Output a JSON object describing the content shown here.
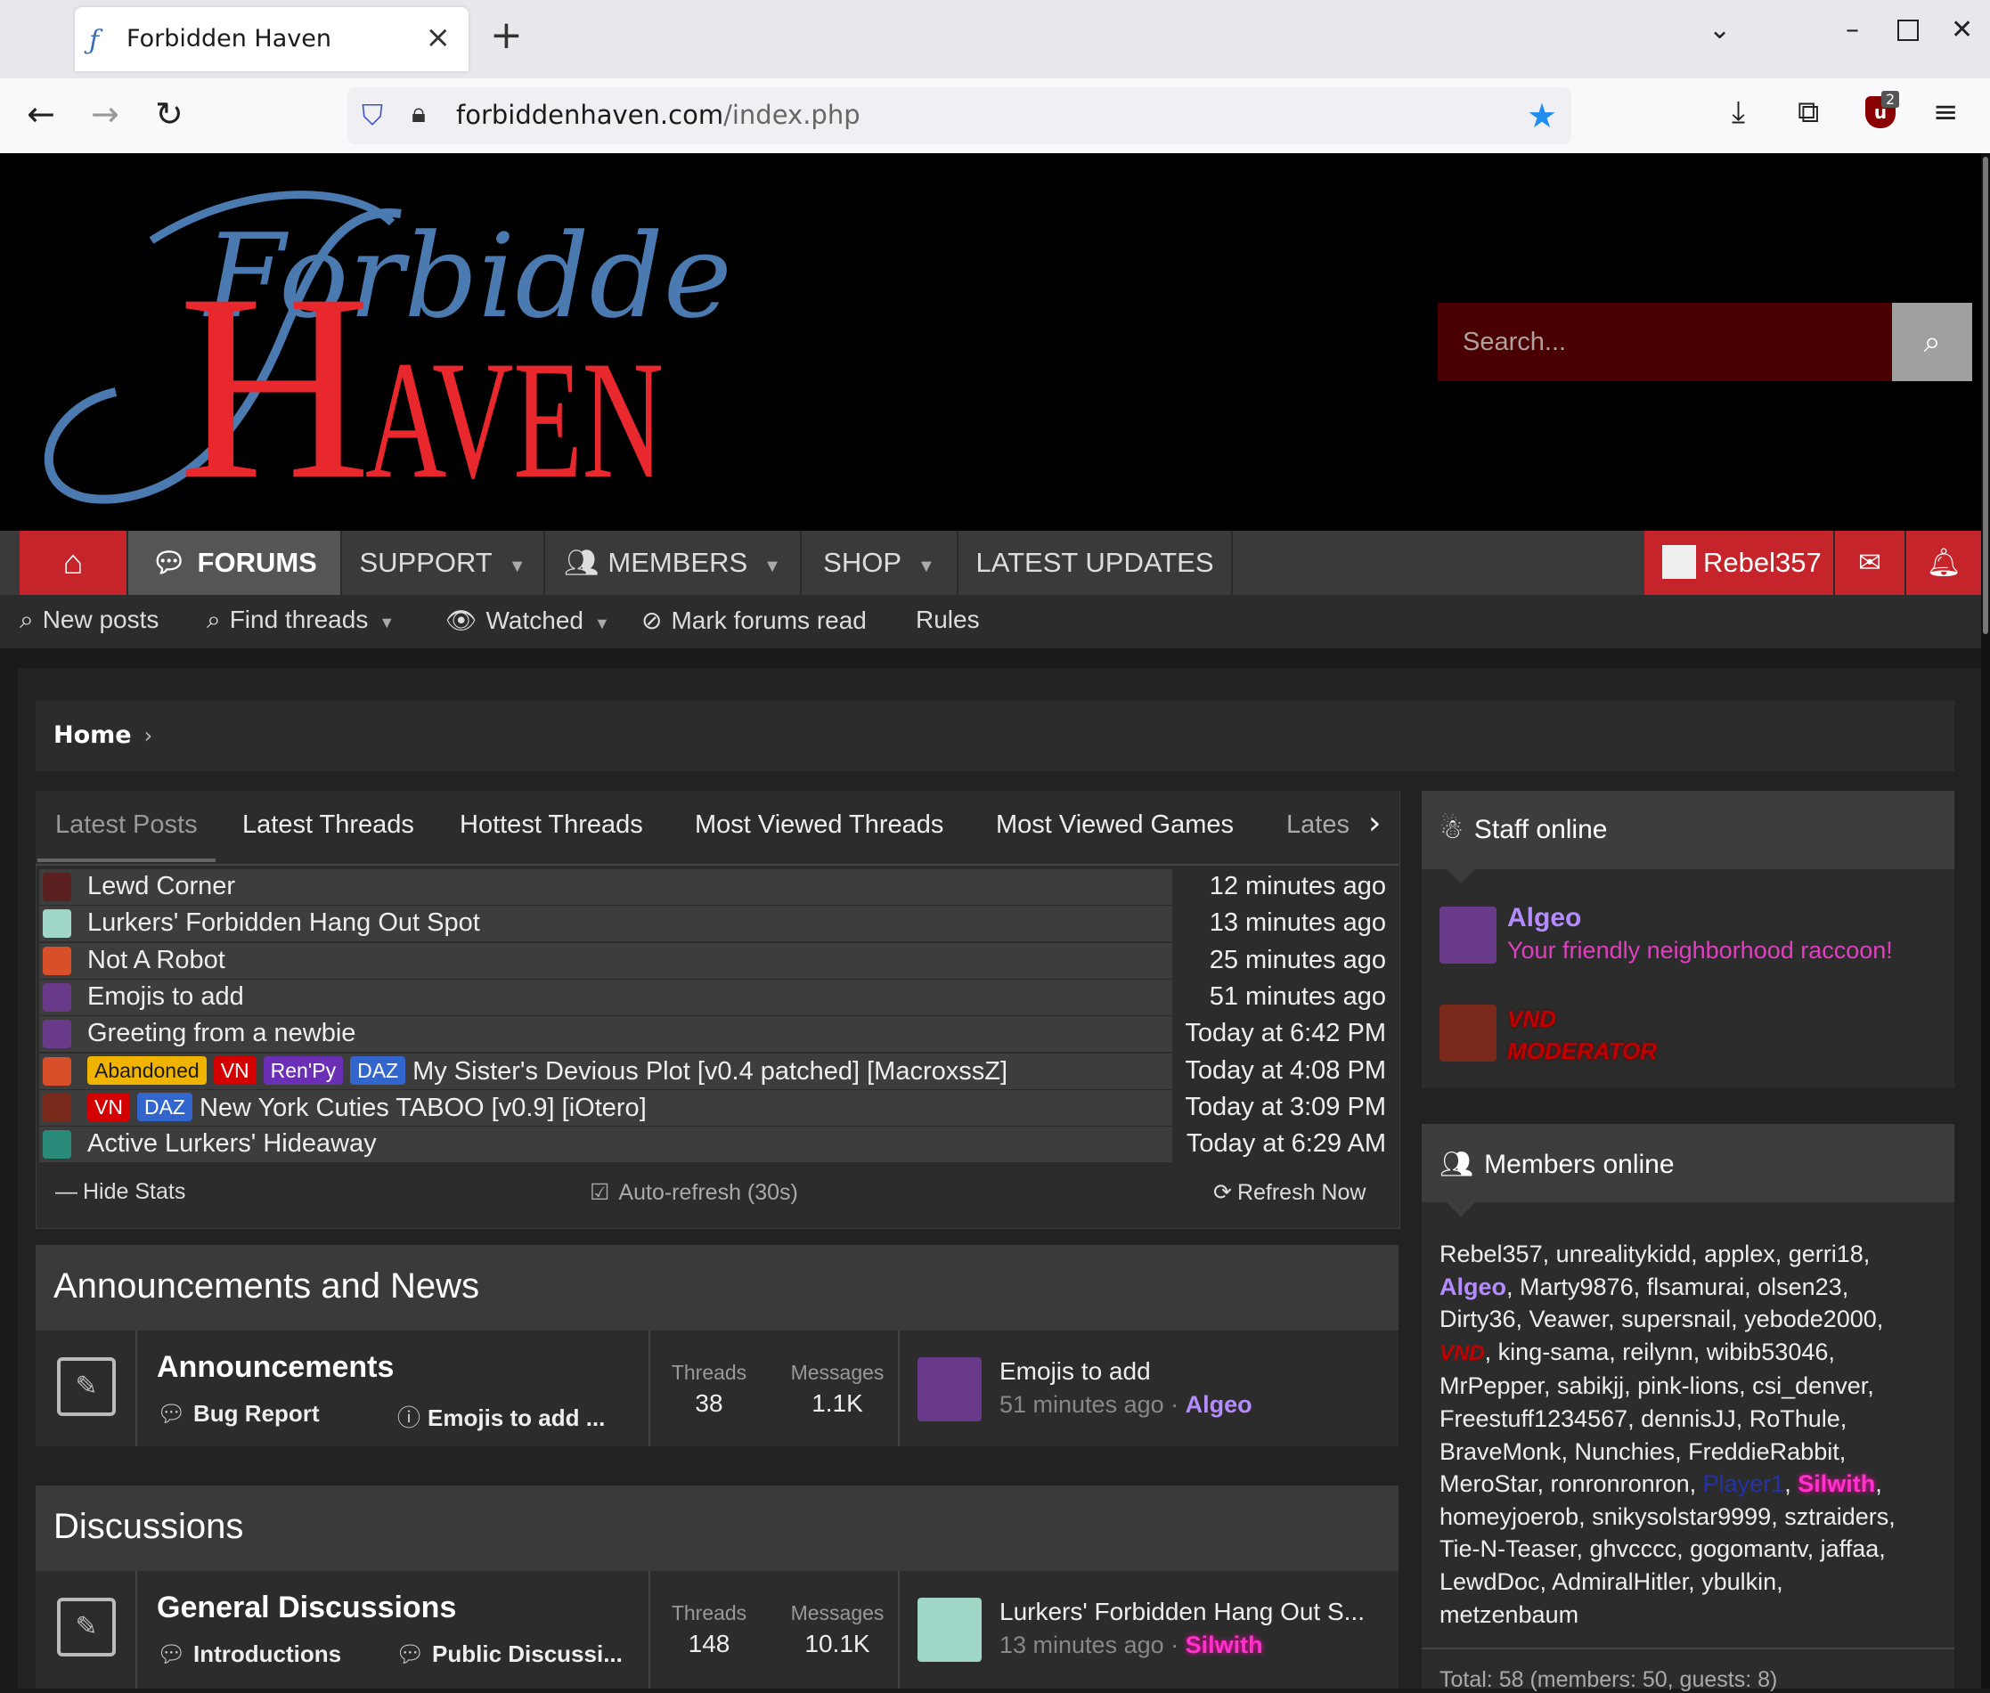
{
  "browser": {
    "tab_title": "Forbidden Haven",
    "url_host": "forbiddenhaven.com",
    "url_path": "/index.php",
    "extension_badge": "2"
  },
  "site": {
    "logo_script": "Forbidden",
    "logo_caps": "AVEN",
    "logo_initial": "H",
    "search_placeholder": "Search..."
  },
  "nav": {
    "forums": "FORUMS",
    "support": "SUPPORT",
    "members": "MEMBERS",
    "shop": "SHOP",
    "latest_updates": "LATEST UPDATES",
    "username": "Rebel357"
  },
  "subnav": {
    "new_posts": "New posts",
    "find_threads": "Find threads",
    "watched": "Watched",
    "mark_read": "Mark forums read",
    "rules": "Rules"
  },
  "breadcrumb": {
    "home": "Home"
  },
  "stats": {
    "tabs": [
      "Latest Posts",
      "Latest Threads",
      "Hottest Threads",
      "Most Viewed Threads",
      "Most Viewed Games",
      "Lates"
    ],
    "rows": [
      {
        "prefixes": [],
        "title": "Lewd Corner",
        "time": "12 minutes ago",
        "avatar_color": "#5a2020"
      },
      {
        "prefixes": [],
        "title": "Lurkers' Forbidden Hang Out Spot",
        "time": "13 minutes ago",
        "avatar_color": "#9fd6c8"
      },
      {
        "prefixes": [],
        "title": "Not A Robot",
        "time": "25 minutes ago",
        "avatar_color": "#d8502a"
      },
      {
        "prefixes": [],
        "title": "Emojis to add",
        "time": "51 minutes ago",
        "avatar_color": "#6a3a8a"
      },
      {
        "prefixes": [],
        "title": "Greeting from a newbie",
        "time": "Today at 6:42 PM",
        "avatar_color": "#6a3a8a"
      },
      {
        "prefixes": [
          "Abandoned",
          "VN",
          "Ren'Py",
          "DAZ"
        ],
        "title": "My Sister's Devious Plot [v0.4 patched] [MacroxssZ]",
        "time": "Today at 4:08 PM",
        "avatar_color": "#d8502a"
      },
      {
        "prefixes": [
          "VN",
          "DAZ"
        ],
        "title": "New York Cuties TABOO [v0.9] [iOtero]",
        "time": "Today at 3:09 PM",
        "avatar_color": "#7a2a1a"
      },
      {
        "prefixes": [],
        "title": "Active Lurkers' Hideaway",
        "time": "Today at 6:29 AM",
        "avatar_color": "#2a8a7a"
      }
    ],
    "hide_stats": "Hide Stats",
    "auto_refresh": "Auto-refresh (30s)",
    "refresh_now": "Refresh Now"
  },
  "categories": [
    {
      "title": "Announcements and News",
      "forum": {
        "name": "Announcements",
        "subforums": [
          "Bug Report",
          "Emojis to add ..."
        ],
        "threads_label": "Threads",
        "threads": "38",
        "messages_label": "Messages",
        "messages": "1.1K",
        "last_title": "Emojis to add",
        "last_time": "51 minutes ago",
        "last_user": "Algeo"
      }
    },
    {
      "title": "Discussions",
      "forum": {
        "name": "General Discussions",
        "subforums": [
          "Introductions",
          "Public Discussi..."
        ],
        "threads_label": "Threads",
        "threads": "148",
        "messages_label": "Messages",
        "messages": "10.1K",
        "last_title": "Lurkers' Forbidden Hang Out S...",
        "last_time": "13 minutes ago",
        "last_user": "Silwith"
      }
    }
  ],
  "sidebar": {
    "staff_title": "Staff online",
    "staff": [
      {
        "name": "Algeo",
        "desc": "Your friendly neighborhood raccoon!"
      },
      {
        "name": "VND",
        "desc": "MODERATOR"
      }
    ],
    "members_title": "Members online",
    "members_line1": "Rebel357, unrealitykidd, applex, gerri18,",
    "members_algeo": "Algeo",
    "members_line2": ", Marty9876, flsamurai, olsen23,",
    "members_line3": "Dirty36, Veawer, supersnail, yebode2000,",
    "members_vnd": "VND",
    "members_line4": ", king-sama, reilynn, wibib53046,",
    "members_line5": "MrPepper, sabikjj, pink-lions, csi_denver,",
    "members_line6": "Freestuff1234567, dennisJJ, RoThule,",
    "members_line7": "BraveMonk, Nunchies, FreddieRabbit,",
    "members_line8": "MeroStar, ronronronron, ",
    "members_player": "Player1",
    "members_silwith": "Silwith",
    "members_line9": "homeyjoerob, snikysolstar9999, sztraiders,",
    "members_line10": "Tie-N-Teaser, ghvcccc, gogomantv, jaffaa,",
    "members_line11": "LewdDoc, AdmiralHitler, ybulkin,",
    "members_line12": "metzenbaum",
    "members_total": "Total: 58 (members: 50, guests: 8)"
  },
  "colors": {
    "brand_red": "#c4242a",
    "logo_blue": "#4a7ab0",
    "logo_red": "#e8282c",
    "staff_purple": "#b48cff",
    "staff_magenta": "#e040c0"
  }
}
